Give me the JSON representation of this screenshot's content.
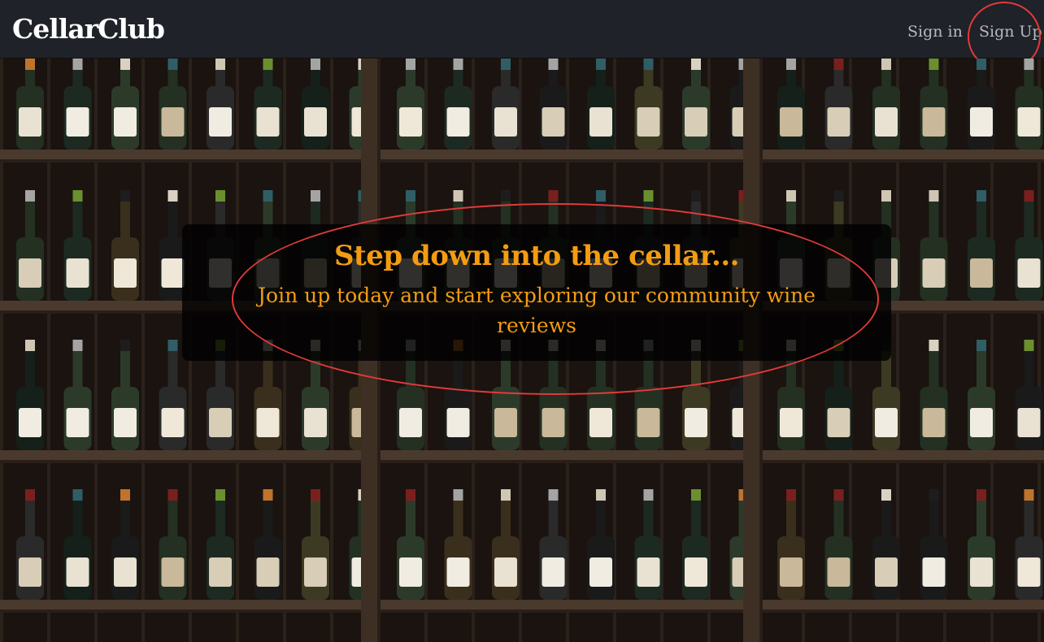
{
  "header": {
    "brand": "CellarClub",
    "nav": {
      "sign_in": "Sign in",
      "sign_up": "Sign Up"
    }
  },
  "hero": {
    "title": "Step down into the cellar...",
    "subtitle": "Join up today and start exploring our community wine reviews",
    "background": "wine-rack-photo"
  },
  "colors": {
    "header_bg": "#1f2228",
    "brand_text": "#ffffff",
    "nav_text": "#b9b9bd",
    "accent": "#f39c12",
    "annotation": "#e23a3a"
  }
}
